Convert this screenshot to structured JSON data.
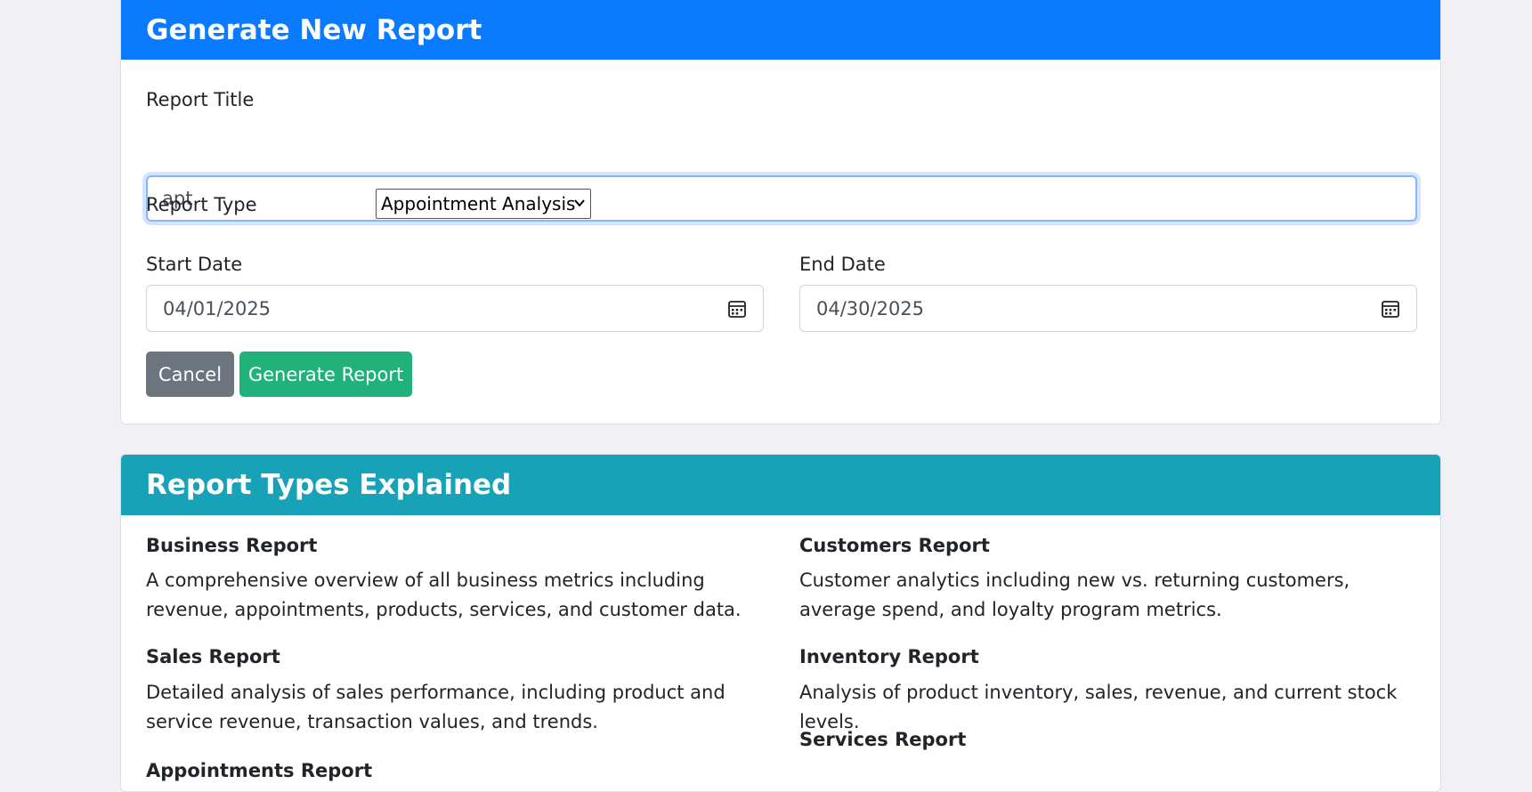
{
  "generate": {
    "header": "Generate New Report",
    "title_label": "Report Title",
    "title_value": "apt",
    "type_label": "Report Type",
    "type_selected": "Appointment Analysis",
    "start_label": "Start Date",
    "start_value": "04/01/2025",
    "end_label": "End Date",
    "end_value": "04/30/2025",
    "cancel_label": "Cancel",
    "generate_label": "Generate Report"
  },
  "types": {
    "header": "Report Types Explained",
    "items": [
      {
        "title": "Business Report",
        "desc": "A comprehensive overview of all business metrics including revenue, appointments, products, services, and customer data."
      },
      {
        "title": "Sales Report",
        "desc": "Detailed analysis of sales performance, including product and service revenue, transaction values, and trends."
      },
      {
        "title": "Appointments Report",
        "desc": ""
      },
      {
        "title": "Customers Report",
        "desc": "Customer analytics including new vs. returning customers, average spend, and loyalty program metrics."
      },
      {
        "title": "Inventory Report",
        "desc": "Analysis of product inventory, sales, revenue, and current stock levels."
      },
      {
        "title": "Services Report",
        "desc": ""
      }
    ]
  },
  "colors": {
    "primary": "#0a7bff",
    "info": "#17a2b8",
    "secondary": "#6c757d",
    "success": "#20b27a"
  },
  "icons": {
    "select": "chevron-down-icon",
    "date": "calendar-icon"
  }
}
